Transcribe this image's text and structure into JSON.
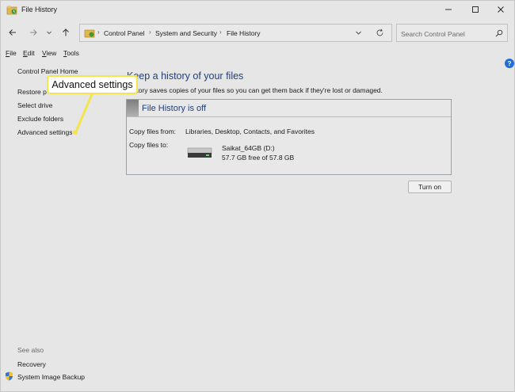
{
  "window": {
    "title": "File History",
    "accent_color": "#1f3f7a",
    "callout_color": "#f4e54a"
  },
  "titlebar": {
    "app_icon": "file-history-icon",
    "minimize_icon": "minimize-icon",
    "maximize_icon": "maximize-icon",
    "close_icon": "close-icon"
  },
  "navigation": {
    "back_icon": "arrow-left-icon",
    "forward_icon": "arrow-right-icon",
    "recent_icon": "chevron-down-icon",
    "up_icon": "arrow-up-icon",
    "breadcrumbs": [
      "Control Panel",
      "System and Security",
      "File History"
    ],
    "refresh_icon": "refresh-icon"
  },
  "search": {
    "placeholder": "Search Control Panel",
    "value": ""
  },
  "menu": {
    "items": [
      {
        "key": "F",
        "rest": "ile"
      },
      {
        "key": "E",
        "rest": "dit"
      },
      {
        "key": "V",
        "rest": "iew"
      },
      {
        "key": "T",
        "rest": "ools"
      }
    ],
    "help_label": "?"
  },
  "sidebar": {
    "home": "Control Panel Home",
    "links": [
      "Restore p",
      "Select drive",
      "Exclude folders",
      "Advanced settings"
    ],
    "see_also_label": "See also",
    "see_also_links": [
      "Recovery",
      "System Image Backup"
    ]
  },
  "main": {
    "heading": "Keep a history of your files",
    "description": "History saves copies of your files so you can get them back if they're lost or damaged.",
    "status_title": "File History is off",
    "copy_from_label": "Copy files from:",
    "copy_from_value": "Libraries, Desktop, Contacts, and Favorites",
    "copy_to_label": "Copy files to:",
    "drive_name": "Saikat_64GB (D:)",
    "drive_free": "57.7 GB free of 57.8 GB",
    "turn_on_label": "Turn on"
  },
  "callout": {
    "text": "Advanced settings"
  }
}
